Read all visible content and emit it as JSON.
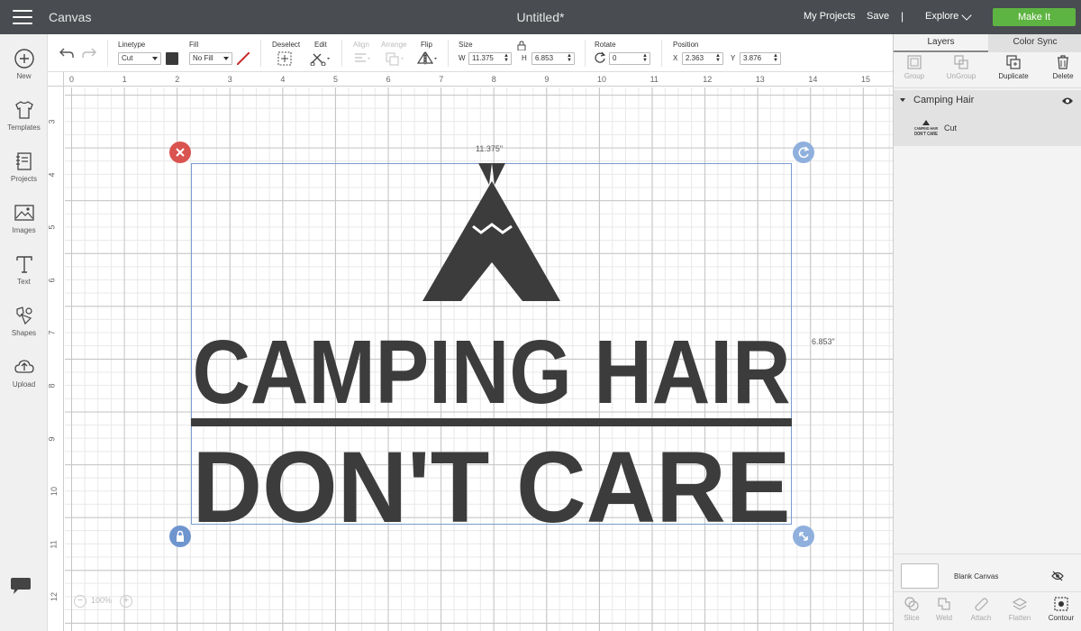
{
  "header": {
    "app_title": "Canvas",
    "doc_title": "Untitled*",
    "my_projects": "My Projects",
    "save": "Save",
    "separator": "|",
    "explore": "Explore",
    "make_it": "Make It"
  },
  "rail": {
    "new": "New",
    "templates": "Templates",
    "projects": "Projects",
    "images": "Images",
    "text": "Text",
    "shapes": "Shapes",
    "upload": "Upload"
  },
  "toolbar": {
    "linetype_label": "Linetype",
    "linetype_value": "Cut",
    "fill_label": "Fill",
    "fill_value": "No Fill",
    "deselect_label": "Deselect",
    "edit_label": "Edit",
    "align_label": "Align",
    "arrange_label": "Arrange",
    "flip_label": "Flip",
    "size_label": "Size",
    "w_label": "W",
    "w_value": "11.375",
    "h_label": "H",
    "h_value": "6.853",
    "rotate_label": "Rotate",
    "rotate_value": "0",
    "position_label": "Position",
    "x_label": "X",
    "x_value": "2.363",
    "y_label": "Y",
    "y_value": "3.876",
    "colors": {
      "swatch": "#3a3a3a",
      "accent_green": "#5eb442"
    }
  },
  "canvas": {
    "ruler_top": [
      "0",
      "1",
      "2",
      "3",
      "4",
      "5",
      "6",
      "7",
      "8",
      "9",
      "10",
      "11",
      "12",
      "13",
      "14",
      "15"
    ],
    "ruler_left": [
      "3",
      "4",
      "5",
      "6",
      "7",
      "8",
      "9",
      "10",
      "11",
      "12"
    ],
    "width_readout": "11.375\"",
    "height_readout": "6.853\"",
    "zoom": "100%",
    "zoom_minus": "−",
    "zoom_plus": "+",
    "design_line1": "CAMPING HAIR",
    "design_line2": "DON'T CARE"
  },
  "panel": {
    "tab_layers": "Layers",
    "tab_color_sync": "Color Sync",
    "group": "Group",
    "ungroup": "UnGroup",
    "duplicate": "Duplicate",
    "delete": "Delete",
    "layer_name": "Camping Hair",
    "layer_operation": "Cut",
    "thumb_line1": "CAMPING HAIR",
    "thumb_line2": "DON'T CARE",
    "blank_canvas": "Blank Canvas",
    "slice": "Slice",
    "weld": "Weld",
    "attach": "Attach",
    "flatten": "Flatten",
    "contour": "Contour"
  }
}
